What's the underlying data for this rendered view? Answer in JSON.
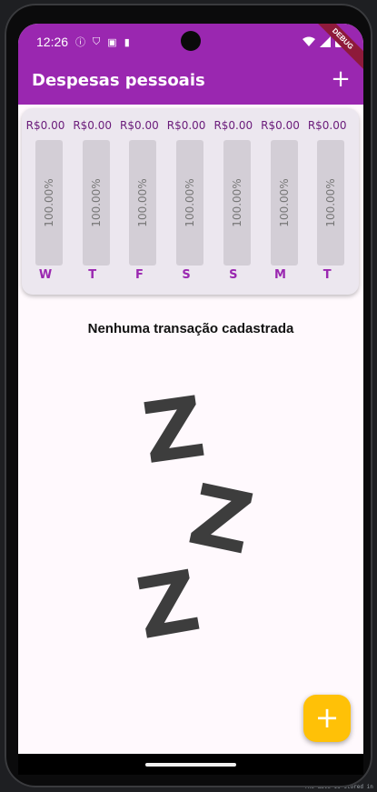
{
  "status_bar": {
    "time": "12:26",
    "icons": [
      "alert-icon",
      "shield-icon",
      "a-icon",
      "sd-icon",
      "wifi-icon",
      "signal-icon",
      "battery-icon"
    ],
    "debug_banner": "DEBUG"
  },
  "appbar": {
    "title": "Despesas pessoais",
    "add_label": "+",
    "color": "#9a27b0"
  },
  "chart_data": {
    "type": "bar",
    "categories": [
      "W",
      "T",
      "F",
      "S",
      "S",
      "M",
      "T"
    ],
    "amounts": [
      "R$0.00",
      "R$0.00",
      "R$0.00",
      "R$0.00",
      "R$0.00",
      "R$0.00",
      "R$0.00"
    ],
    "percent_labels": [
      "100.00%",
      "100.00%",
      "100.00%",
      "100.00%",
      "100.00%",
      "100.00%",
      "100.00%"
    ],
    "values": [
      0,
      0,
      0,
      0,
      0,
      0,
      0
    ]
  },
  "empty_state": {
    "message": "Nenhuma transação cadastrada",
    "art": [
      "Z",
      "Z",
      "Z"
    ]
  },
  "fab": {
    "label": "+",
    "color": "#ffc107"
  }
}
